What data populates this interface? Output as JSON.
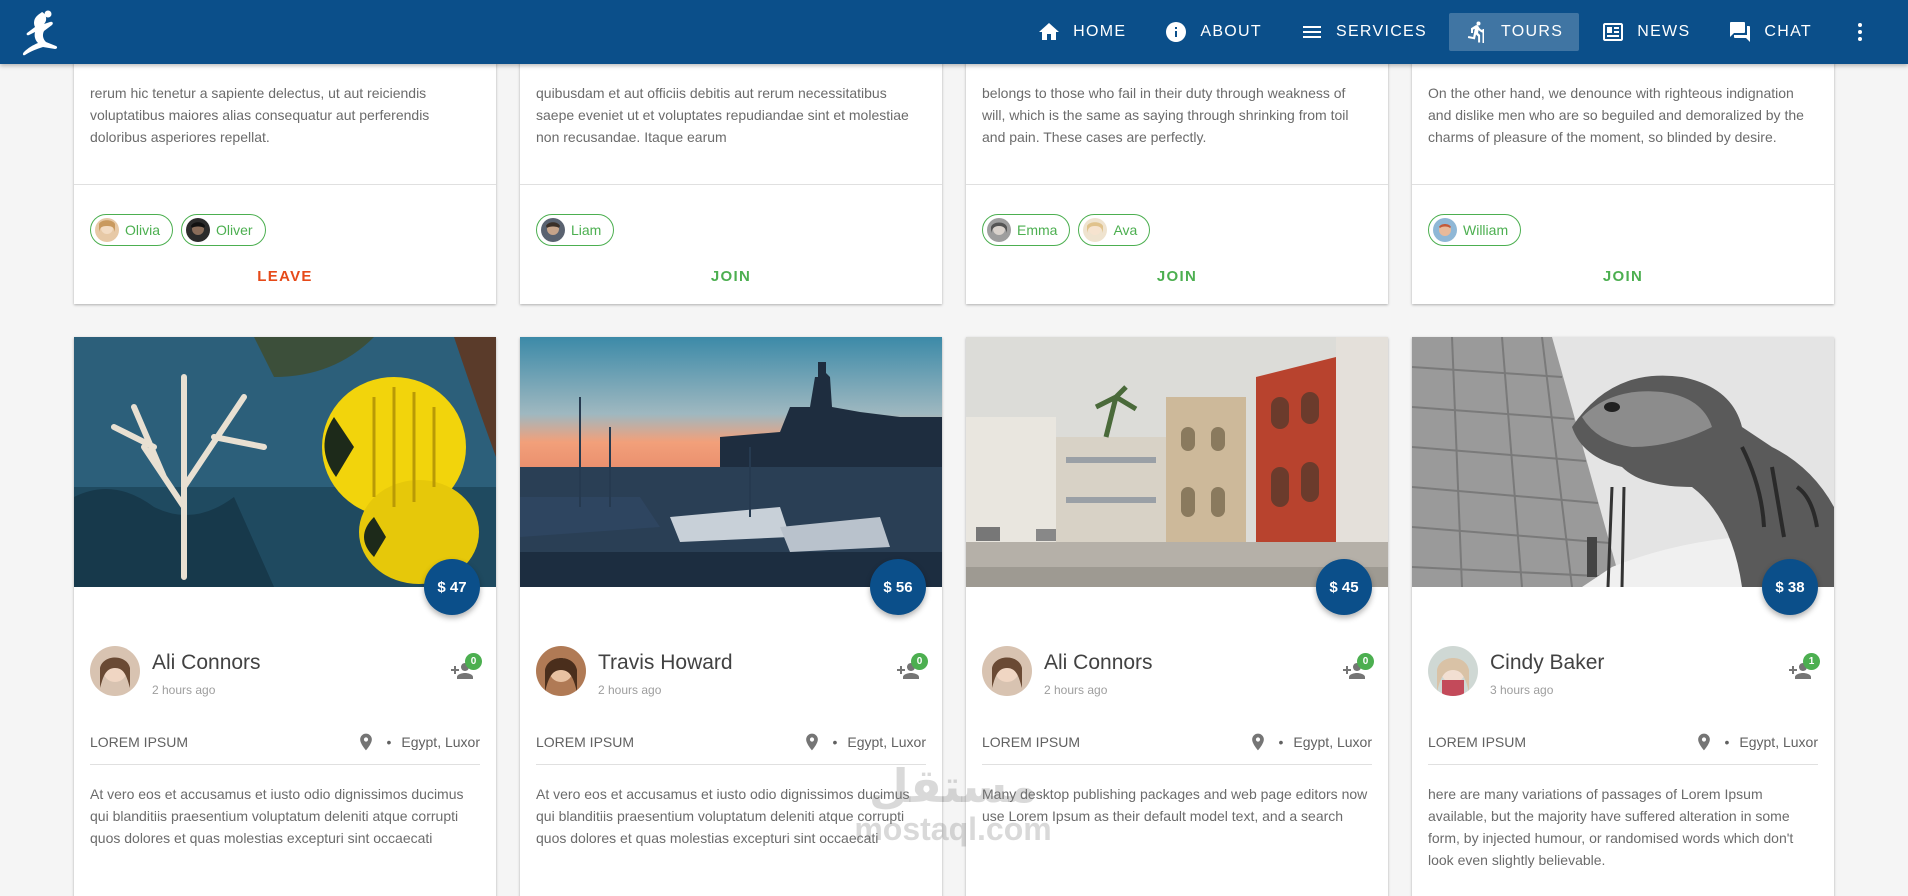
{
  "nav": {
    "items": [
      {
        "label": "HOME",
        "icon": "home-icon"
      },
      {
        "label": "ABOUT",
        "icon": "info-icon"
      },
      {
        "label": "SERVICES",
        "icon": "list-icon"
      },
      {
        "label": "TOURS",
        "icon": "hiking-icon",
        "active": true
      },
      {
        "label": "NEWS",
        "icon": "newspaper-icon"
      },
      {
        "label": "CHAT",
        "icon": "forum-icon"
      }
    ],
    "more_icon": "more-vert-icon"
  },
  "top_cards": [
    {
      "description": "rerum hic tenetur a sapiente delectus, ut aut reiciendis voluptatibus maiores alias consequatur aut perferendis doloribus asperiores repellat.",
      "members": [
        "Olivia",
        "Oliver"
      ],
      "action": "LEAVE"
    },
    {
      "description": "quibusdam et aut officiis debitis aut rerum necessitatibus saepe eveniet ut et voluptates repudiandae sint et molestiae non recusandae. Itaque earum",
      "members": [
        "Liam"
      ],
      "action": "JOIN"
    },
    {
      "description": "belongs to those who fail in their duty through weakness of will, which is the same as saying through shrinking from toil and pain. These cases are perfectly.",
      "members": [
        "Emma",
        "Ava"
      ],
      "action": "JOIN"
    },
    {
      "description": "On the other hand, we denounce with righteous indignation and dislike men who are so beguiled and demoralized by the charms of pleasure of the moment, so blinded by desire.",
      "members": [
        "William"
      ],
      "action": "JOIN"
    }
  ],
  "tour_cards": [
    {
      "image": "reef-fish-photo",
      "price": "$ 47",
      "author": "Ali Connors",
      "time": "2 hours ago",
      "join_count": "0",
      "category": "LOREM IPSUM",
      "location": "Egypt, Luxor",
      "description": "At vero eos et accusamus et iusto odio dignissimos ducimus qui blanditiis praesentium voluptatum deleniti atque corrupti quos dolores et quas molestias excepturi sint occaecati"
    },
    {
      "image": "harbor-sunset-photo",
      "price": "$ 56",
      "author": "Travis Howard",
      "time": "2 hours ago",
      "join_count": "0",
      "category": "LOREM IPSUM",
      "location": "Egypt, Luxor",
      "description": "At vero eos et accusamus et iusto odio dignissimos ducimus qui blanditiis praesentium voluptatum deleniti atque corrupti quos dolores et quas molestias excepturi sint occaecati"
    },
    {
      "image": "street-buildings-photo",
      "price": "$ 45",
      "author": "Ali Connors",
      "time": "2 hours ago",
      "join_count": "0",
      "category": "LOREM IPSUM",
      "location": "Egypt, Luxor",
      "description": "Many desktop publishing packages and web page editors now use Lorem Ipsum as their default model text, and a search"
    },
    {
      "image": "camel-pyramid-photo",
      "price": "$ 38",
      "author": "Cindy Baker",
      "time": "3 hours ago",
      "join_count": "1",
      "category": "LOREM IPSUM",
      "location": "Egypt, Luxor",
      "description": "here are many variations of passages of Lorem Ipsum available, but the majority have suffered alteration in some form, by injected humour, or randomised words which don't look even slightly believable."
    }
  ],
  "watermark": {
    "arabic": "مستقل",
    "latin": "mostaql.com"
  },
  "colors": {
    "primary": "#0b4f8a",
    "accent_green": "#4caf50",
    "leave_red": "#e64a19"
  }
}
